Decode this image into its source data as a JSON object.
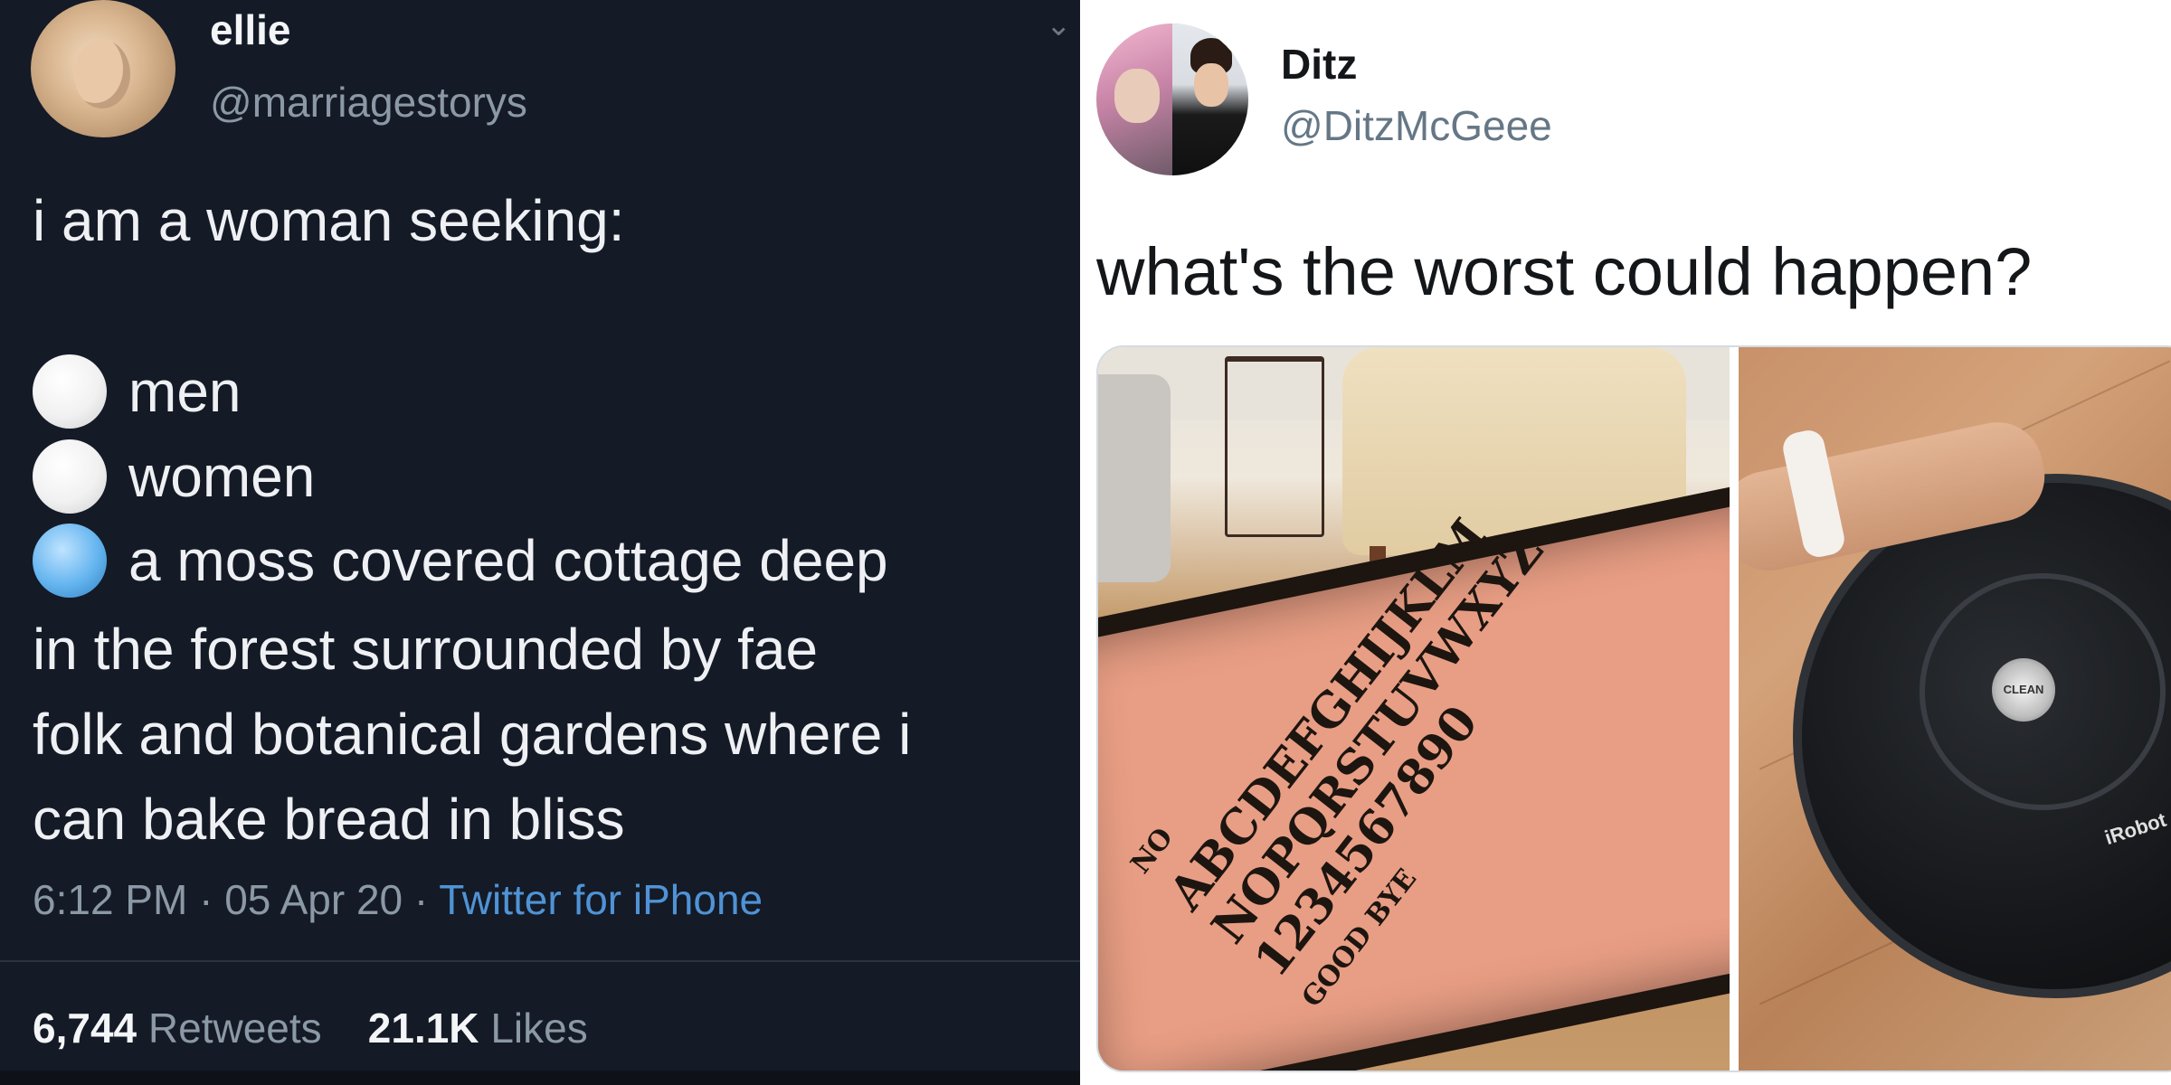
{
  "left_tweet": {
    "display_name": "ellie",
    "handle": "@marriagestorys",
    "text_line1": "i am a woman seeking:",
    "poll_options": [
      {
        "label": "men",
        "selected": false
      },
      {
        "label": "women",
        "selected": false
      },
      {
        "label": "a moss covered cottage deep",
        "selected": true
      }
    ],
    "continuation_lines": [
      "in the forest surrounded by fae",
      "folk and botanical gardens where i",
      "can bake bread in bliss"
    ],
    "time": "6:12 PM",
    "date": "05 Apr 20",
    "source": "Twitter for iPhone",
    "retweets_count": "6,744",
    "retweets_label": "Retweets",
    "likes_count": "21.1K",
    "likes_label": "Likes",
    "colors": {
      "background": "#141a26",
      "link": "#4f93d6"
    }
  },
  "right_tweet": {
    "display_name": "Ditz",
    "handle": "@DitzMcGeee",
    "text": "what's the worst could happen?",
    "media": {
      "ouija_letters_row1": "ABCDEFGHIJKLM",
      "ouija_letters_row2": "NOPQRSTUVWXYZ",
      "ouija_numbers": "1234567890",
      "ouija_no": "NO",
      "ouija_goodbye": "GOOD BYE",
      "roomba_button": "CLEAN",
      "roomba_brand": "iRobot"
    }
  }
}
